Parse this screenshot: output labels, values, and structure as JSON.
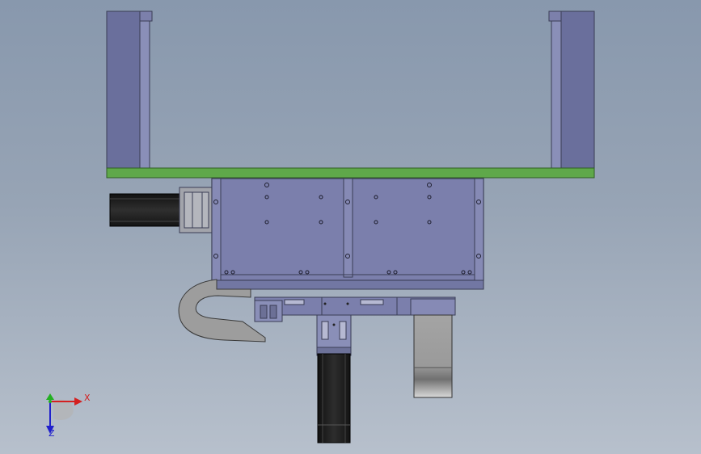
{
  "scene": {
    "colors": {
      "background_top": "#8898ad",
      "background_bottom": "#b7c0cc",
      "part_purple": "#7a7fab",
      "part_edge": "#3a3d55",
      "plate_green": "#5fa84a",
      "motor_black": "#1e1e1e",
      "bracket_gray": "#9a9ca4",
      "cable_gray": "#9d9d9d"
    }
  },
  "triad": {
    "x_label": "X",
    "z_label": "Z",
    "x_color": "#d42020",
    "y_color": "#22b022",
    "z_color": "#2020cc"
  }
}
